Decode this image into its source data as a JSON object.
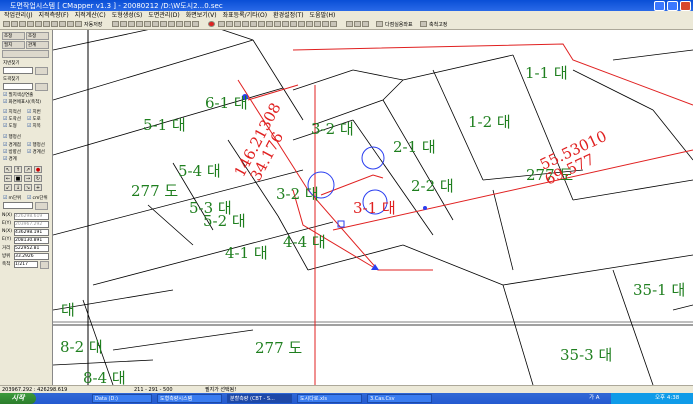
{
  "window": {
    "title": "도면작업시스템 [ CMapper v1.3 ] - 20080212 /D:\\W도시2...0.sec"
  },
  "menu": [
    "작업관리(J)",
    "지적측량(F)",
    "지적계산(C)",
    "도형생성(S)",
    "도면관리(D)",
    "화면보기(V)",
    "좌표등록/기타(O)",
    "환경설정(T)",
    "도움말(H)"
  ],
  "toolbar": {
    "auto_label": "자동저장",
    "auto_label2": "다점실용좌표",
    "scale_label": "축척고정"
  },
  "panel": {
    "top_buttons": [
      "조정",
      "조정",
      "필지",
      "관계"
    ],
    "search1_label": "지번찾기",
    "search2_label": "도곽찾기",
    "checks": [
      "필지색상연출",
      "화면에표시(축척)",
      "지적선",
      "지번",
      "도곽선",
      "도로",
      "도형",
      "지목",
      "행정선",
      "경계점",
      "행정선",
      "방향선",
      "경계선",
      "경계",
      "지적선",
      "행정선"
    ],
    "unit1": "m단위",
    "unit2": "cm단위",
    "coords": [
      {
        "label": "N(X)",
        "value": "426298.619"
      },
      {
        "label": "E(Y)",
        "value": "203967.292"
      },
      {
        "label": "N(X)",
        "value": "436298.191"
      },
      {
        "label": "E(Y)",
        "value": "208130.891"
      },
      {
        "label": "거리",
        "value": "522952.81"
      },
      {
        "label": "방위",
        "value": "33.2926"
      },
      {
        "label": "축척",
        "value": "1/217"
      }
    ]
  },
  "map": {
    "parcels": [
      {
        "label": "1-1 대"
      },
      {
        "label": "6-1 대"
      },
      {
        "label": "1-2 대"
      },
      {
        "label": "5-1 대"
      },
      {
        "label": "3-2 대"
      },
      {
        "label": "2-1 대"
      },
      {
        "label": "5-4 대"
      },
      {
        "label": "277 도"
      },
      {
        "label": "3-2 대"
      },
      {
        "label": "2-2 대"
      },
      {
        "label": "5-3 대"
      },
      {
        "label": "5-2 대"
      },
      {
        "label": "4-1 대"
      },
      {
        "label": "4-4 대"
      },
      {
        "label": "277 도"
      },
      {
        "label": "35-1 대"
      },
      {
        "label": "대"
      },
      {
        "label": "8-2 대"
      },
      {
        "label": "277 도"
      },
      {
        "label": "35-3 대"
      },
      {
        "label": "8-4 대"
      }
    ],
    "red_labels": {
      "left_dim1": "146.21308",
      "left_dim2": "34.176",
      "center_parcel": "3-1 대",
      "right_dim1": "55.53010",
      "right_dim2": "69.577"
    }
  },
  "status": {
    "coords": "203967.292 : 426298.619",
    "scale": "211 - 291 - 500",
    "message": "필지가 선택됨!"
  },
  "taskbar": {
    "start": "시작",
    "tasks": [
      "Data (D:)",
      "도형측량시스템",
      "분할측량 (CBT - S...",
      "도시다로.xls",
      "3.Cas.Csv"
    ],
    "lang": "가 A",
    "clock": "오후 4:38"
  },
  "colors": {
    "parcel_label": "#1f7f1f",
    "red_line": "#e02020",
    "blue_circle": "#2a3ef0",
    "title_bar": "#0a4fd6"
  }
}
